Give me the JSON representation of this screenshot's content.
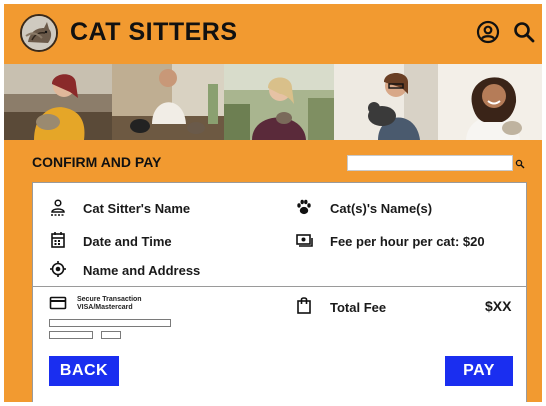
{
  "header": {
    "brand": "CAT SITTERS",
    "logo_icon": "cat-logo-icon",
    "account_icon": "user-circle-icon",
    "search_icon": "search-icon"
  },
  "photos": [
    {
      "name": "photo-woman-with-cat"
    },
    {
      "name": "photo-man-with-cats"
    },
    {
      "name": "photo-woman-holding-kitten"
    },
    {
      "name": "photo-woman-with-glasses-and-cat"
    },
    {
      "name": "photo-smiling-woman"
    }
  ],
  "section": {
    "title": "CONFIRM AND PAY",
    "search_value": ""
  },
  "details": {
    "sitter_name": "Cat Sitter's Name",
    "date_time": "Date and Time",
    "name_address": "Name and Address",
    "cat_names": "Cat(s)'s Name(s)",
    "fee": "Fee per hour per cat: $20"
  },
  "payment": {
    "secure_label": "Secure Transaction",
    "card_types": "VISA/Mastercard",
    "total_label": "Total Fee",
    "total_value": "$XX"
  },
  "buttons": {
    "back": "BACK",
    "pay": "PAY"
  },
  "colors": {
    "background": "#f29a30",
    "button": "#1a2ef0",
    "card": "#ffffff"
  }
}
